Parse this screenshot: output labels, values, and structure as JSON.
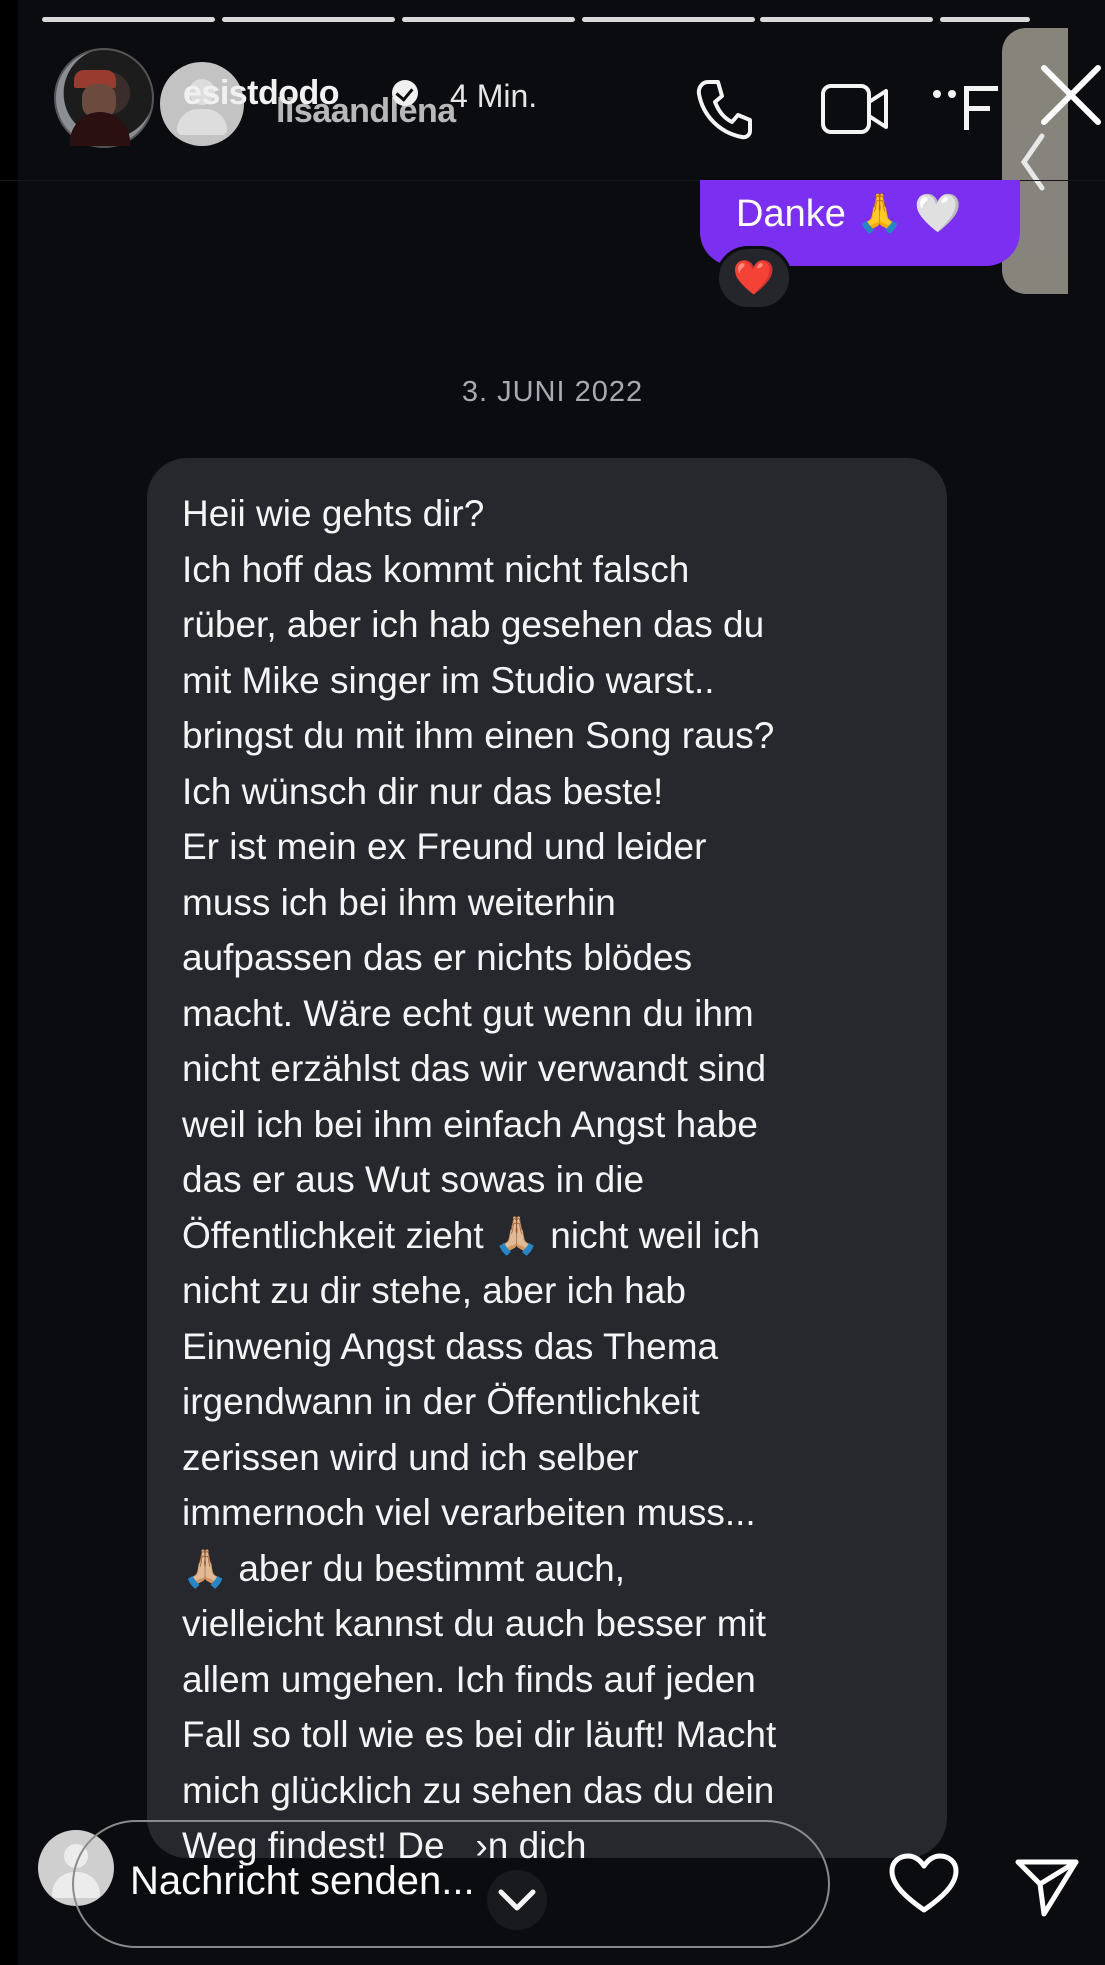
{
  "header": {
    "username_top": "esistdodo",
    "username_under": "lisaandlena",
    "time_ago": "4 Min.",
    "icons": {
      "phone": "phone-icon",
      "video": "video-camera-icon",
      "more": "more-icon",
      "close": "close-icon",
      "side_handle": "chevron-left-icon"
    }
  },
  "story_progress": {
    "segments": 6,
    "active_index": 5
  },
  "chat": {
    "sent_message": "Danke 🙏 🤍",
    "reaction": "❤️",
    "date_label": "3. JUNI 2022",
    "received_message": "Heii wie gehts dir?\nIch hoff das kommt nicht falsch\nrüber, aber ich hab gesehen das du\nmit Mike singer im Studio warst..\nbringst du mit ihm einen Song raus?\nIch wünsch dir nur das beste!\nEr ist mein ex Freund und leider\nmuss ich bei ihm weiterhin\naufpassen das er nichts blödes\nmacht. Wäre echt gut wenn du ihm\nnicht erzählst das wir verwandt sind\nweil ich bei ihm einfach Angst habe\ndas er aus Wut sowas in die\nÖffentlichkeit zieht 🙏🏼 nicht weil ich\nnicht zu dir stehe, aber ich hab\nEinwenig Angst dass das Thema\nirgendwann in der Öffentlichkeit\nzerissen wird und ich selber\nimmernoch viel verarbeiten muss...\n🙏🏼 aber du bestimmt auch,\nvielleicht kannst du auch besser mit\nallem umgehen. Ich finds auf jeden\nFall so toll wie es bei dir läuft! Macht\nmich glücklich zu sehen das du dein\nWeg findest! De   ›n dich"
  },
  "composer": {
    "placeholder": "Nachricht senden...",
    "icons": {
      "heart": "heart-icon",
      "send": "send-icon",
      "chevron": "chevron-down-icon"
    }
  },
  "colors": {
    "background": "#0b0c10",
    "sent_bubble": "#7b2ff0",
    "received_bubble": "#26282e",
    "side_handle": "#8d8b82"
  }
}
